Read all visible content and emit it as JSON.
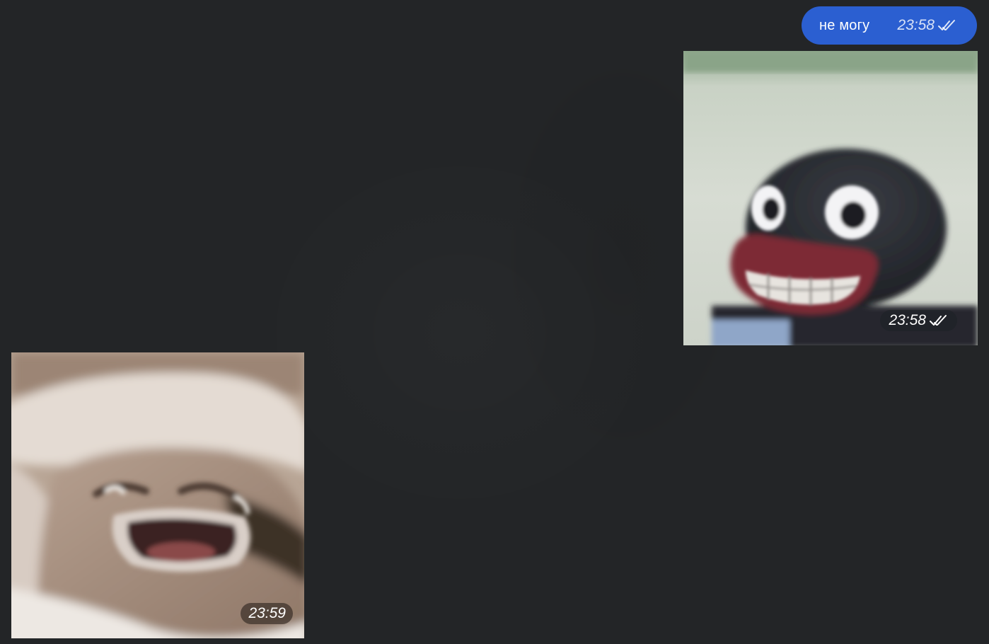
{
  "chat": {
    "messages": [
      {
        "direction": "outgoing",
        "type": "text",
        "text": "не могу",
        "time": "23:58",
        "status": "read",
        "status_icon": "double-check-icon",
        "bubble_color": "#2b5fd1"
      },
      {
        "direction": "outgoing",
        "type": "sticker",
        "sticker": "pingu-grinning-sticker",
        "time": "23:58",
        "status": "read",
        "status_icon": "double-check-icon"
      },
      {
        "direction": "incoming",
        "type": "sticker",
        "sticker": "crying-face-sticker",
        "time": "23:59"
      }
    ]
  },
  "theme": {
    "background": "#232527"
  }
}
